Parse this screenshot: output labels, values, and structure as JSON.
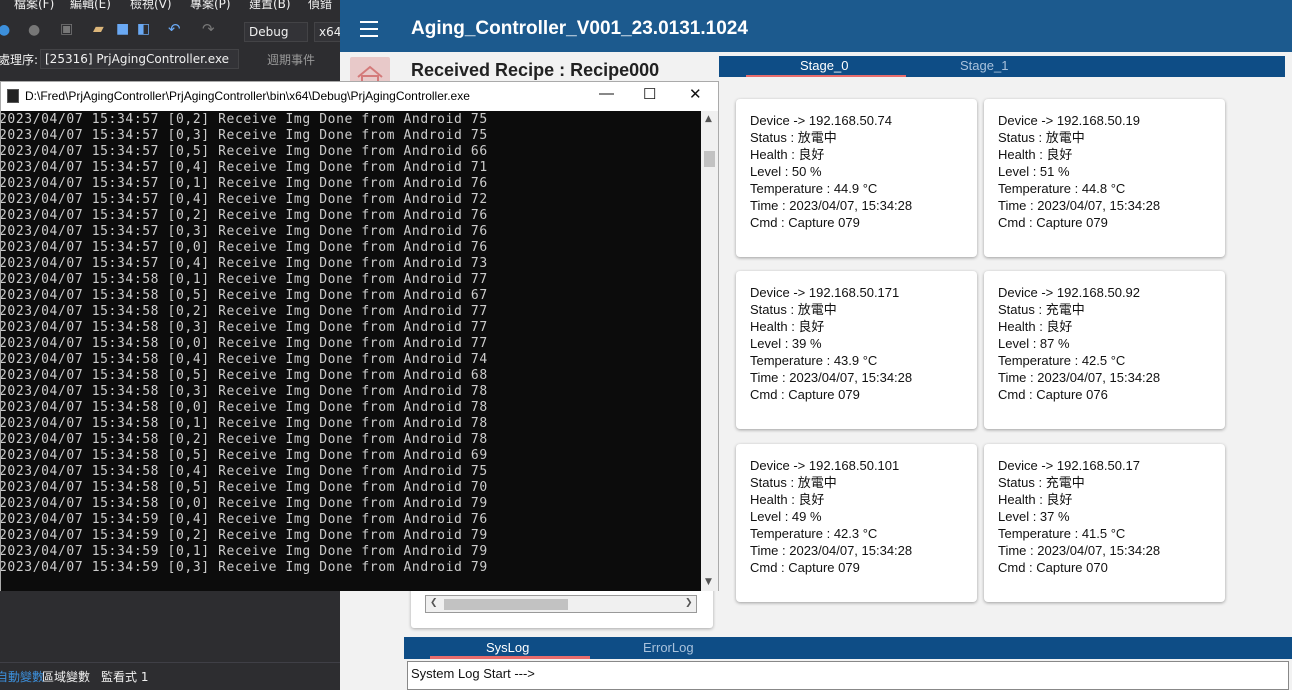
{
  "vs": {
    "menu": [
      "檔案(F)",
      "編輯(E)",
      "檢視(V)",
      "專案(P)",
      "建置(B)",
      "偵錯(D)"
    ],
    "toolbar": {
      "config": "Debug",
      "platform": "x64"
    },
    "process_label": "處理序:",
    "process_value": "[25316] PrjAgingController.exe",
    "events_label": "週期事件",
    "bottom_tabs": [
      "自動變數",
      "區域變數",
      "監看式 1"
    ]
  },
  "app": {
    "title": "Aging_Controller_V001_23.0131.1024",
    "recipe": "Received Recipe : Recipe000",
    "stage_tabs": [
      "Stage_0",
      "Stage_1"
    ],
    "devices": [
      {
        "device": "Device -> 192.168.50.74",
        "status": "Status : 放電中",
        "health": "Health : 良好",
        "level": "Level : 50 %",
        "temperature": "Temperature : 44.9 °C",
        "time": "Time : 2023/04/07, 15:34:28",
        "cmd": "Cmd : Capture 079"
      },
      {
        "device": "Device -> 192.168.50.19",
        "status": "Status : 放電中",
        "health": "Health : 良好",
        "level": "Level : 51 %",
        "temperature": "Temperature : 44.8 °C",
        "time": "Time : 2023/04/07, 15:34:28",
        "cmd": "Cmd : Capture 079"
      },
      {
        "device": "Device -> 192.168.50.171",
        "status": "Status : 放電中",
        "health": "Health : 良好",
        "level": "Level : 39 %",
        "temperature": "Temperature : 43.9 °C",
        "time": "Time : 2023/04/07, 15:34:28",
        "cmd": "Cmd : Capture 079"
      },
      {
        "device": "Device -> 192.168.50.92",
        "status": "Status : 充電中",
        "health": "Health : 良好",
        "level": "Level : 87 %",
        "temperature": "Temperature : 42.5 °C",
        "time": "Time : 2023/04/07, 15:34:28",
        "cmd": "Cmd : Capture 076"
      },
      {
        "device": "Device -> 192.168.50.101",
        "status": "Status : 放電中",
        "health": "Health : 良好",
        "level": "Level : 49 %",
        "temperature": "Temperature : 42.3 °C",
        "time": "Time : 2023/04/07, 15:34:28",
        "cmd": "Cmd : Capture 079"
      },
      {
        "device": "Device -> 192.168.50.17",
        "status": "Status : 充電中",
        "health": "Health : 良好",
        "level": "Level : 37 %",
        "temperature": "Temperature : 41.5 °C",
        "time": "Time : 2023/04/07, 15:34:28",
        "cmd": "Cmd : Capture 070"
      }
    ],
    "log_tabs": [
      "SysLog",
      "ErrorLog"
    ],
    "log_text": "System Log Start --->"
  },
  "console": {
    "title": "D:\\Fred\\PrjAgingController\\PrjAgingController\\bin\\x64\\Debug\\PrjAgingController.exe",
    "lines": [
      "2023/04/07 15:34:57 [0,2] Receive Img Done from Android 75",
      "2023/04/07 15:34:57 [0,3] Receive Img Done from Android 75",
      "2023/04/07 15:34:57 [0,5] Receive Img Done from Android 66",
      "2023/04/07 15:34:57 [0,4] Receive Img Done from Android 71",
      "2023/04/07 15:34:57 [0,1] Receive Img Done from Android 76",
      "2023/04/07 15:34:57 [0,4] Receive Img Done from Android 72",
      "2023/04/07 15:34:57 [0,2] Receive Img Done from Android 76",
      "2023/04/07 15:34:57 [0,3] Receive Img Done from Android 76",
      "2023/04/07 15:34:57 [0,0] Receive Img Done from Android 76",
      "2023/04/07 15:34:57 [0,4] Receive Img Done from Android 73",
      "2023/04/07 15:34:58 [0,1] Receive Img Done from Android 77",
      "2023/04/07 15:34:58 [0,5] Receive Img Done from Android 67",
      "2023/04/07 15:34:58 [0,2] Receive Img Done from Android 77",
      "2023/04/07 15:34:58 [0,3] Receive Img Done from Android 77",
      "2023/04/07 15:34:58 [0,0] Receive Img Done from Android 77",
      "2023/04/07 15:34:58 [0,4] Receive Img Done from Android 74",
      "2023/04/07 15:34:58 [0,5] Receive Img Done from Android 68",
      "2023/04/07 15:34:58 [0,3] Receive Img Done from Android 78",
      "2023/04/07 15:34:58 [0,0] Receive Img Done from Android 78",
      "2023/04/07 15:34:58 [0,1] Receive Img Done from Android 78",
      "2023/04/07 15:34:58 [0,2] Receive Img Done from Android 78",
      "2023/04/07 15:34:58 [0,5] Receive Img Done from Android 69",
      "2023/04/07 15:34:58 [0,4] Receive Img Done from Android 75",
      "2023/04/07 15:34:58 [0,5] Receive Img Done from Android 70",
      "2023/04/07 15:34:58 [0,0] Receive Img Done from Android 79",
      "2023/04/07 15:34:59 [0,4] Receive Img Done from Android 76",
      "2023/04/07 15:34:59 [0,2] Receive Img Done from Android 79",
      "2023/04/07 15:34:59 [0,1] Receive Img Done from Android 79",
      "2023/04/07 15:34:59 [0,3] Receive Img Done from Android 79"
    ]
  }
}
